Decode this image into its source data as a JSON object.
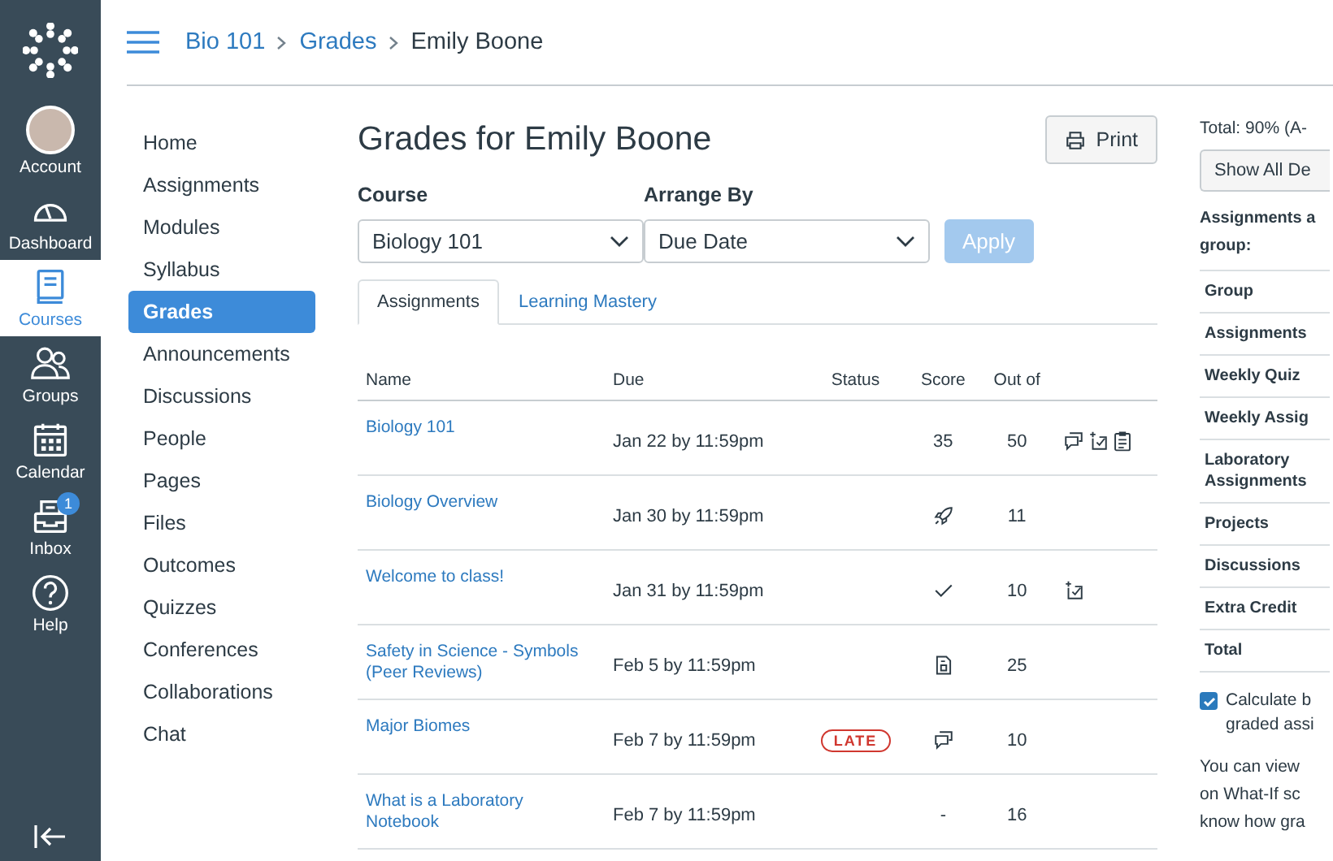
{
  "global_nav": [
    {
      "label": "Account",
      "selected": false
    },
    {
      "label": "Dashboard",
      "selected": false
    },
    {
      "label": "Courses",
      "selected": true
    },
    {
      "label": "Groups",
      "selected": false
    },
    {
      "label": "Calendar",
      "selected": false
    },
    {
      "label": "Inbox",
      "selected": false,
      "badge": "1"
    },
    {
      "label": "Help",
      "selected": false
    }
  ],
  "breadcrumbs": [
    "Bio 101",
    "Grades",
    "Emily Boone"
  ],
  "course_nav": [
    {
      "label": "Home",
      "selected": false
    },
    {
      "label": "Assignments",
      "selected": false
    },
    {
      "label": "Modules",
      "selected": false
    },
    {
      "label": "Syllabus",
      "selected": false
    },
    {
      "label": "Grades",
      "selected": true
    },
    {
      "label": "Announcements",
      "selected": false
    },
    {
      "label": "Discussions",
      "selected": false
    },
    {
      "label": "People",
      "selected": false
    },
    {
      "label": "Pages",
      "selected": false
    },
    {
      "label": "Files",
      "selected": false
    },
    {
      "label": "Outcomes",
      "selected": false
    },
    {
      "label": "Quizzes",
      "selected": false
    },
    {
      "label": "Conferences",
      "selected": false
    },
    {
      "label": "Collaborations",
      "selected": false
    },
    {
      "label": "Chat",
      "selected": false
    }
  ],
  "title": "Grades for Emily Boone",
  "print_button": "Print",
  "filters": [
    {
      "label": "Course",
      "value": "Biology 101"
    },
    {
      "label": "Arrange By",
      "value": "Due Date"
    }
  ],
  "apply_button": {
    "label": "Apply",
    "disabled": true
  },
  "tabs": [
    {
      "label": "Assignments",
      "selected": true
    },
    {
      "label": "Learning Mastery",
      "selected": false
    }
  ],
  "table": {
    "columns": [
      "Name",
      "Due",
      "Status",
      "Score",
      "Out of"
    ],
    "rows": [
      {
        "name": "Biology 101",
        "due": "Jan 22 by 11:59pm",
        "score": {
          "kind": "text",
          "text": "35"
        },
        "out_of": "50",
        "actions": [
          {
            "kind": "comment"
          },
          {
            "kind": "rubric-check"
          },
          {
            "kind": "clipboard"
          }
        ]
      },
      {
        "name": "Biology Overview",
        "due": "Jan 30 by 11:59pm",
        "score": {
          "kind": "rocket"
        },
        "out_of": "11",
        "actions": []
      },
      {
        "name": "Welcome to class!",
        "due": "Jan 31 by 11:59pm",
        "score": {
          "kind": "check"
        },
        "out_of": "10",
        "actions": [
          {
            "kind": "rubric-check"
          }
        ]
      },
      {
        "name": "Safety in Science - Symbols (Peer Reviews)",
        "due": "Feb 5 by 11:59pm",
        "score": {
          "kind": "document"
        },
        "out_of": "25",
        "actions": []
      },
      {
        "name": "Major Biomes",
        "due": "Feb 7 by 11:59pm",
        "status": "LATE",
        "score": {
          "kind": "comment"
        },
        "out_of": "10",
        "actions": []
      },
      {
        "name": "What is a Laboratory Notebook",
        "due": "Feb 7 by 11:59pm",
        "score": {
          "kind": "text",
          "text": "-"
        },
        "out_of": "16",
        "actions": []
      }
    ]
  },
  "sidebar": {
    "total": "Total: 90% (A-",
    "show_all_button": "Show All De",
    "heading_lines": [
      "Assignments a",
      "group:"
    ],
    "groups": [
      "Group",
      "Assignments",
      "Weekly Quiz",
      "Weekly Assig",
      "Laboratory Assignments",
      "Projects",
      "Discussions",
      "Extra Credit",
      "Total"
    ],
    "calculate": {
      "checked": true,
      "lines": [
        "Calculate b",
        "graded assi"
      ]
    },
    "note_lines": [
      "You can view",
      "on What-If sc",
      "know how gra"
    ]
  }
}
